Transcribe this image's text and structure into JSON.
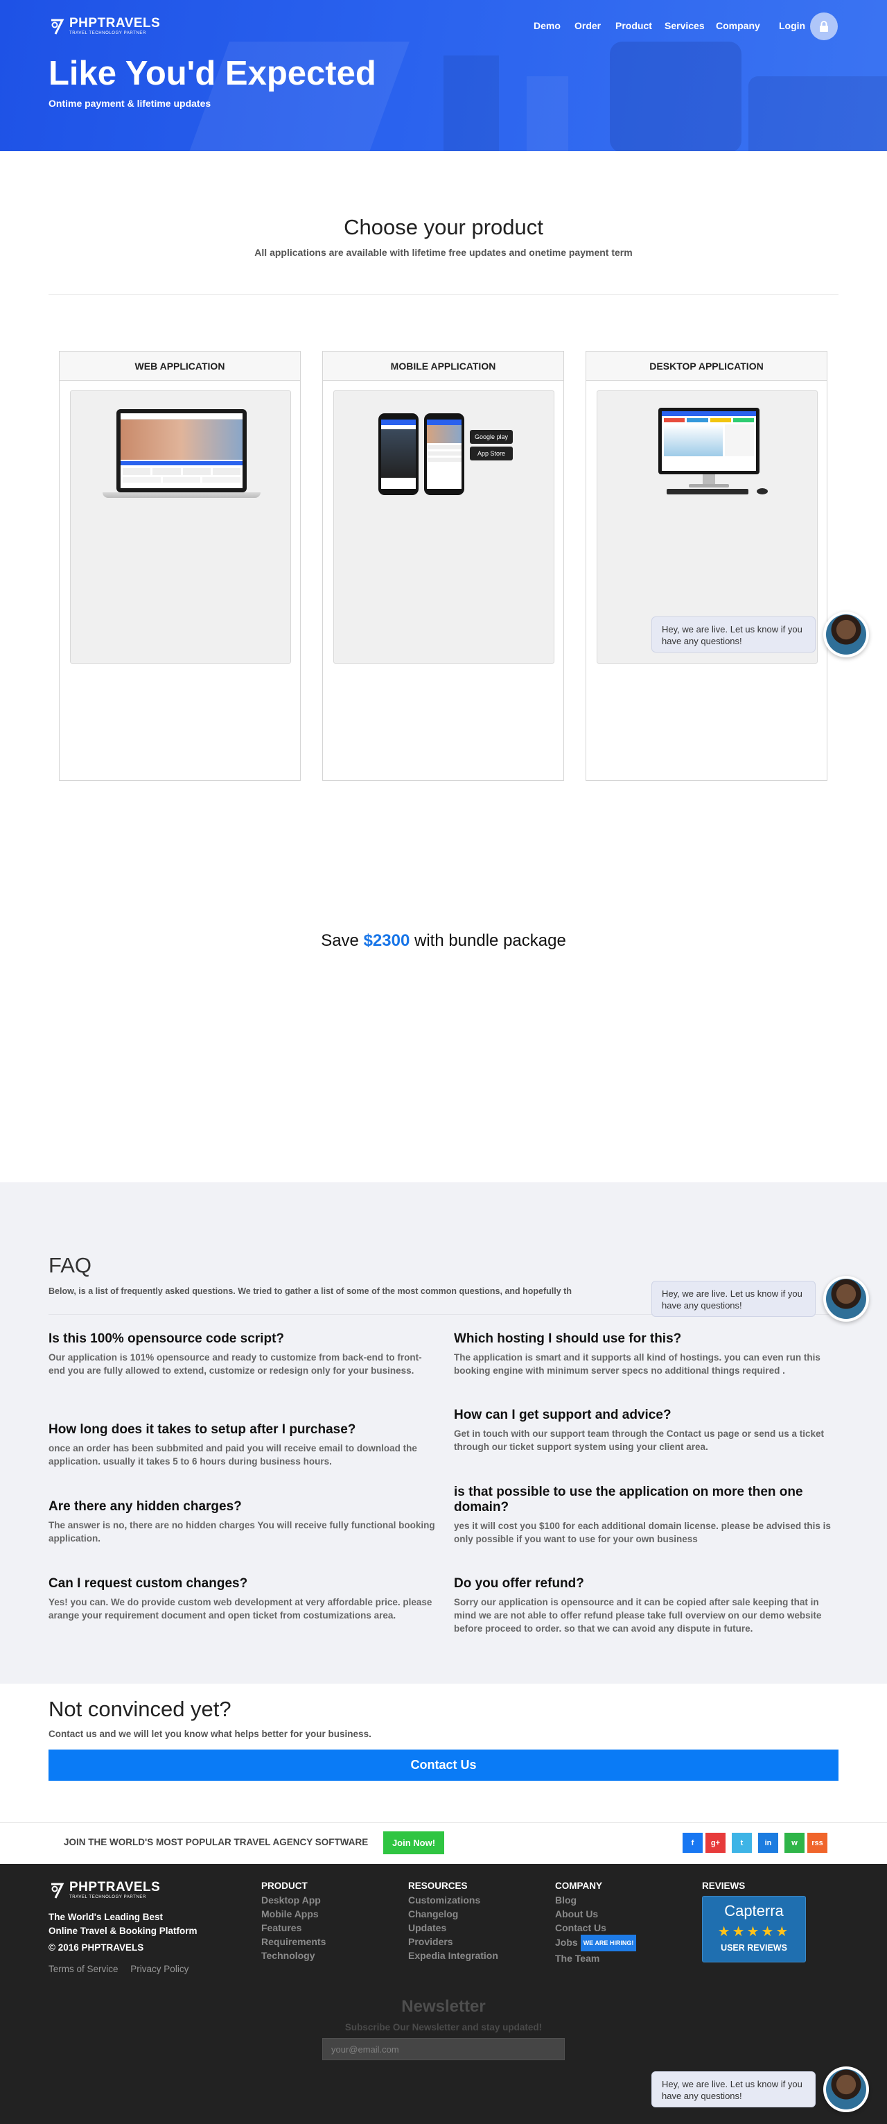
{
  "brand": {
    "name": "PHPTRAVELS",
    "tagline": "TRAVEL TECHNOLOGY PARTNER"
  },
  "nav": {
    "items": [
      "Demo",
      "Order",
      "Product",
      "Services",
      "Company",
      "Login"
    ]
  },
  "hero": {
    "title": "Like You'd Expected",
    "subtitle": "Ontime payment & lifetime updates"
  },
  "products": {
    "title": "Choose your product",
    "subtitle": "All applications are available with lifetime free updates and onetime payment term",
    "panels": [
      {
        "title": "WEB APPLICATION"
      },
      {
        "title": "MOBILE APPLICATION",
        "stores": [
          "Google play",
          "App Store"
        ]
      },
      {
        "title": "DESKTOP APPLICATION"
      }
    ]
  },
  "chat": {
    "message": "Hey, we are live. Let us know if you have any questions!"
  },
  "save": {
    "prefix": "Save",
    "price": "$2300",
    "suffix": "with bundle package"
  },
  "faq": {
    "title": "FAQ",
    "subtitle": "Below, is a list of frequently asked questions. We tried to gather a list of some of the most common questions, and hopefully th",
    "items": [
      {
        "q": "Is this 100% opensource code script?",
        "a": "Our application is 101% opensource and ready to customize from back-end to front-end you are fully allowed to extend, customize or redesign only for your business."
      },
      {
        "q": "Which hosting I should use for this?",
        "a": "The application is smart and it supports all kind of hostings. you can even run this booking engine with minimum server specs no additional things required ."
      },
      {
        "q": "How long does it takes to setup after I purchase?",
        "a": "once an order has been subbmited and paid you will receive email to download the application. usually it takes 5 to 6 hours during business hours."
      },
      {
        "q": "How can I get support and advice?",
        "a": "Get in touch with our support team through the Contact us page or send us a ticket through our ticket support system using your client area."
      },
      {
        "q": "Are there any hidden charges?",
        "a": "The answer is no, there are no hidden charges You will receive fully functional booking application."
      },
      {
        "q": "is that possible to use the application on more then one domain?",
        "a": "yes it will cost you $100 for each additional domain license. please be advised this is only possible if you want to use for your own business"
      },
      {
        "q": "Can I request custom changes?",
        "a": "Yes! you can. We do provide custom web development at very affordable price. please arange your requirement document and open ticket from costumizations area."
      },
      {
        "q": "Do you offer refund?",
        "a": "Sorry our application is opensource and it can be copied after sale keeping that in mind we are not able to offer refund please take full overview on our demo website before proceed to order. so that we can avoid any dispute in future."
      }
    ]
  },
  "convince": {
    "title": "Not convinced yet?",
    "subtitle": "Contact us and we will let you know what helps better for your business.",
    "button": "Contact Us"
  },
  "join": {
    "text": "JOIN THE WORLD'S MOST POPULAR TRAVEL AGENCY SOFTWARE",
    "button": "Join Now!",
    "social": [
      {
        "icon": "f",
        "color": "#1877f2"
      },
      {
        "icon": "g+",
        "color": "#e73b3b"
      },
      {
        "icon": "t",
        "color": "#3eb4e6"
      },
      {
        "icon": "in",
        "color": "#1c7ce0"
      },
      {
        "icon": "w",
        "color": "#2fb549"
      },
      {
        "icon": "rss",
        "color": "#f0652b"
      }
    ]
  },
  "footer": {
    "tagline_line1": "The World's Leading Best",
    "tagline_line2": "Online Travel & Booking Platform",
    "copyright": "© 2016 PHPTRAVELS",
    "legal": [
      "Terms of Service",
      "Privacy Policy"
    ],
    "columns": [
      {
        "title": "PRODUCT",
        "links": [
          "Desktop App",
          "Mobile Apps",
          "Features",
          "Requirements",
          "Technology"
        ]
      },
      {
        "title": "RESOURCES",
        "links": [
          "Customizations",
          "Changelog",
          "Updates",
          "Providers",
          "Expedia Integration"
        ]
      },
      {
        "title": "COMPANY",
        "links": [
          "Blog",
          "About Us",
          "Contact Us",
          "Jobs",
          "The Team"
        ],
        "badge": "WE ARE HIRING!"
      }
    ],
    "reviews": {
      "title": "REVIEWS",
      "brand": "Capterra",
      "stars": "★★★★★",
      "label": "USER REVIEWS"
    },
    "newsletter": {
      "title": "Newsletter",
      "subtitle": "Subscribe Our Newsletter and stay updated!",
      "placeholder": "your@email.com"
    }
  }
}
